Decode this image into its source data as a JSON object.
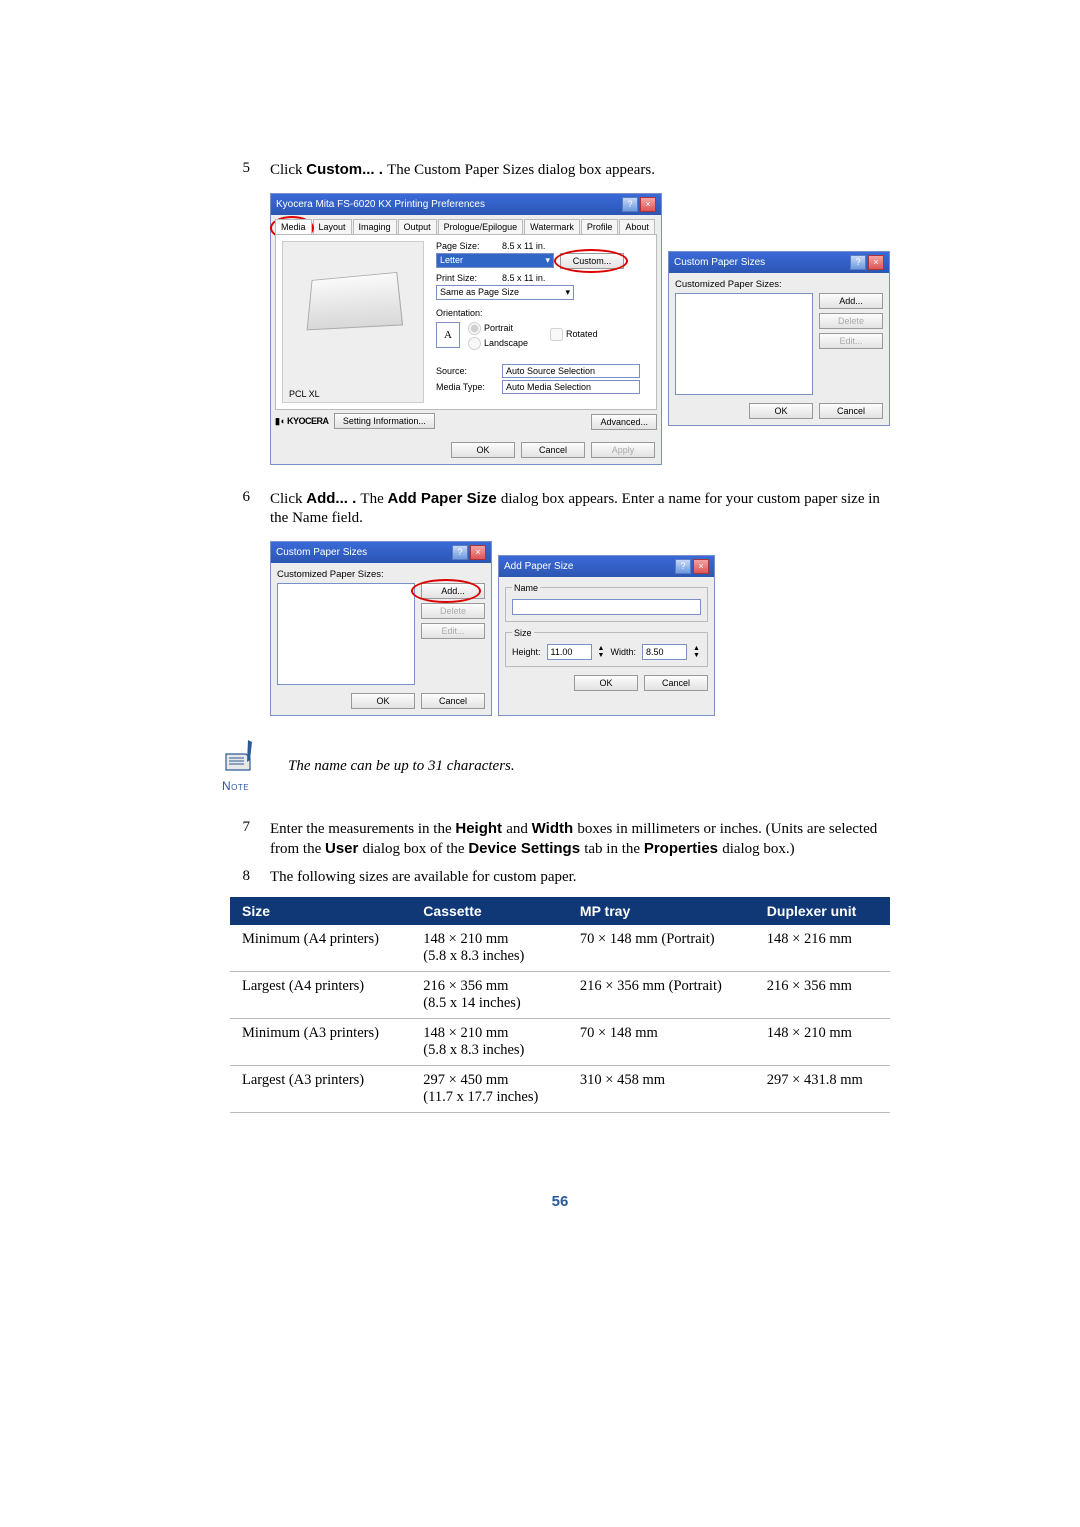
{
  "steps": {
    "s5": {
      "num": "5",
      "pre": "Click ",
      "bold": "Custom... . ",
      "post": "The Custom Paper Sizes dialog box appears."
    },
    "s6": {
      "num": "6",
      "pre": "Click ",
      "bold1": "Add... . ",
      "mid1": "The ",
      "bold2": "Add Paper Size ",
      "post": "dialog box appears. Enter a name for your custom paper size in the Name field."
    },
    "s7": {
      "num": "7",
      "pre": "Enter the measurements in the ",
      "bold1": "Height ",
      "mid1": "and ",
      "bold2": "Width ",
      "mid2": "boxes in millimeters or inches. (Units are selected from the ",
      "bold3": "User ",
      "mid3": "dialog box of the ",
      "bold4": "Device Settings ",
      "mid4": "tab in the ",
      "bold5": "Properties ",
      "post": "dialog box.)"
    },
    "s8": {
      "num": "8",
      "text": "The following sizes are available for custom paper."
    }
  },
  "dlg_main": {
    "title": "Kyocera Mita FS-6020 KX Printing Preferences",
    "tabs": [
      "Media",
      "Layout",
      "Imaging",
      "Output",
      "Prologue/Epilogue",
      "Watermark",
      "Profile",
      "About"
    ],
    "preview_label": "PCL XL",
    "page_size_label": "Page Size:",
    "page_size_val_label": "8.5 x 11 in.",
    "page_size_selected": "Letter",
    "custom_btn": "Custom...",
    "print_size_label": "Print Size:",
    "print_size_val_label": "8.5 x 11 in.",
    "print_size_selected": "Same as Page Size",
    "orientation_label": "Orientation:",
    "portrait": "Portrait",
    "landscape": "Landscape",
    "rotated": "Rotated",
    "source_label": "Source:",
    "source_val": "Auto Source Selection",
    "media_type_label": "Media Type:",
    "media_type_val": "Auto Media Selection",
    "setting_info": "Setting Information...",
    "advanced": "Advanced...",
    "ok": "OK",
    "cancel": "Cancel",
    "apply": "Apply",
    "logo": "KYOCERA"
  },
  "dlg_cps": {
    "title": "Custom Paper Sizes",
    "list_label": "Customized Paper Sizes:",
    "add": "Add...",
    "delete": "Delete",
    "edit": "Edit...",
    "ok": "OK",
    "cancel": "Cancel"
  },
  "dlg_add": {
    "title": "Add Paper Size",
    "name_label": "Name",
    "size_label": "Size",
    "height_label": "Height:",
    "height_val": "11.00",
    "width_label": "Width:",
    "width_val": "8.50",
    "ok": "OK",
    "cancel": "Cancel"
  },
  "note": {
    "label": "Note",
    "text": "The name can be up to 31 characters."
  },
  "table": {
    "headers": [
      "Size",
      "Cassette",
      "MP tray",
      "Duplexer unit"
    ],
    "rows": [
      {
        "size": "Minimum (A4 printers)",
        "cassette_mm": "148 × 210 mm",
        "cassette_in": "(5.8 x 8.3 inches)",
        "mp": "70 × 148 mm (Portrait)",
        "dup": "148 × 216 mm"
      },
      {
        "size": "Largest (A4 printers)",
        "cassette_mm": "216 × 356 mm",
        "cassette_in": "(8.5 x 14 inches)",
        "mp": "216 × 356 mm (Portrait)",
        "dup": "216 × 356 mm"
      },
      {
        "size": "Minimum (A3 printers)",
        "cassette_mm": "148 × 210 mm",
        "cassette_in": "(5.8 x 8.3 inches)",
        "mp": "70 × 148 mm",
        "dup": "148 × 210 mm"
      },
      {
        "size": "Largest (A3 printers)",
        "cassette_mm": "297 × 450 mm",
        "cassette_in": "(11.7 x 17.7 inches)",
        "mp": "310 × 458 mm",
        "dup": "297 × 431.8 mm"
      }
    ]
  },
  "page_number": "56"
}
